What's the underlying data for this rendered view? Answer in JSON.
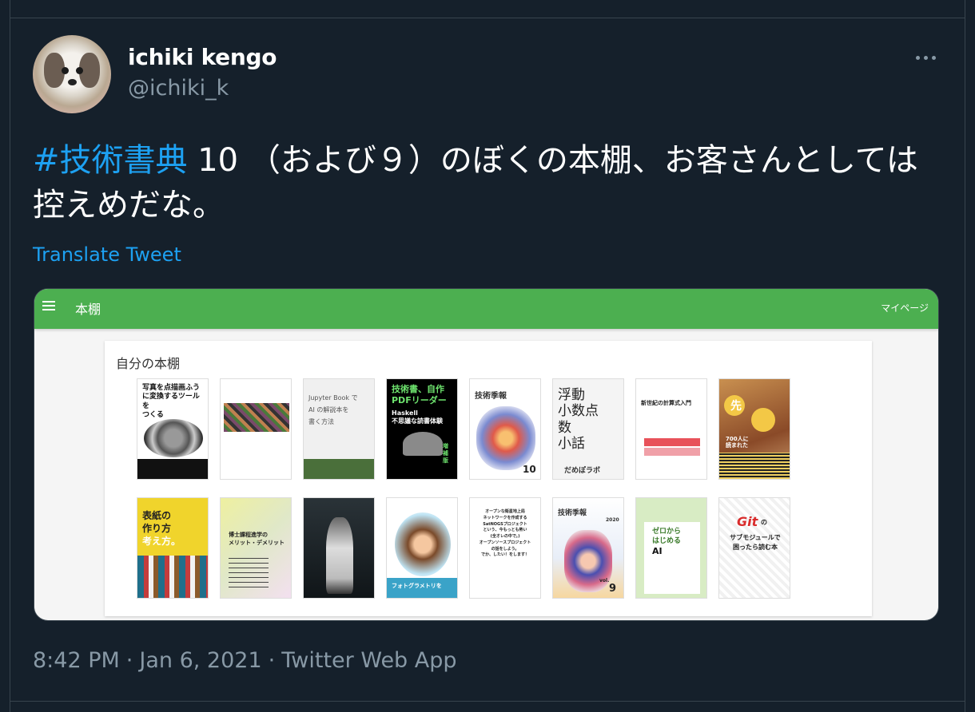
{
  "user": {
    "display_name": "ichiki kengo",
    "handle": "@ichiki_k"
  },
  "tweet": {
    "hashtag": "#技術書典",
    "text": "10 （および９）のぼくの本棚、お客さんとしては控えめだな。",
    "translate_label": "Translate Tweet"
  },
  "media": {
    "app_title": "本棚",
    "mypage_label": "マイページ",
    "section_title": "自分の本棚",
    "books": [
      {
        "lines": [
          "写真を点描画ふう",
          "に変換するツールを",
          "つくる"
        ]
      },
      {
        "lines": []
      },
      {
        "lines": [
          "Jupyter Book で",
          "AI の解説本を",
          "書く方法"
        ]
      },
      {
        "lines": [
          "技術書、自作",
          "PDFリーダー",
          "Haskell",
          "不思議な読書体験",
          "増補版"
        ]
      },
      {
        "lines": [
          "技術季報",
          "10"
        ]
      },
      {
        "lines": [
          "浮動",
          "小数点",
          "数",
          "小話",
          "だめぽラボ"
        ]
      },
      {
        "lines": [
          "新世紀の計算式入門"
        ]
      },
      {
        "lines": [
          "先",
          "700人に",
          "読まれた"
        ]
      },
      {
        "lines": [
          "表紙の",
          "作り方",
          "考え方。"
        ]
      },
      {
        "lines": [
          "博士課程進学の",
          "メリット・デメリット"
        ]
      },
      {
        "lines": []
      },
      {
        "lines": [
          "フォトグラメトリを"
        ]
      },
      {
        "lines": [
          "オープンな衛星地上局",
          "ネットワークを作成する",
          "SatNOGSプロジェクト",
          "という、今もっとも熱い",
          "(全オレの中で。)",
          "オープンソースプロジェクト",
          "の話をしよう。",
          "でか、したい！をします！"
        ]
      },
      {
        "lines": [
          "技術季報",
          "2020",
          "vol.",
          "9"
        ]
      },
      {
        "lines": [
          "ゼロから",
          "はじめる",
          "AI"
        ]
      },
      {
        "lines": [
          "Git",
          "の",
          "サブモジュールで",
          "困ったら読む本"
        ]
      }
    ]
  },
  "meta": {
    "time": "8:42 PM",
    "date": "Jan 6, 2021",
    "source": "Twitter Web App",
    "separator": "·"
  }
}
